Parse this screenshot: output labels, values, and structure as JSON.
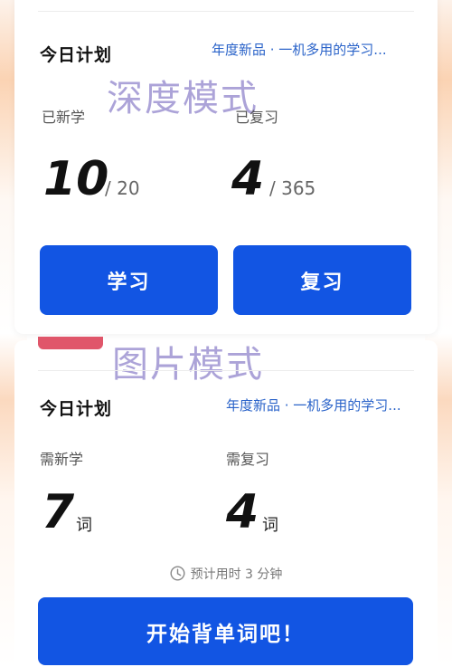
{
  "deep_mode": {
    "watermark": "深度模式",
    "plan_title": "今日计划",
    "plan_link": "年度新品 · 一机多用的学习...",
    "new_label": "已新学",
    "new_count": "10",
    "new_total": "/ 20",
    "review_label": "已复习",
    "review_count": "4",
    "review_total": "/ 365",
    "learn_button": "学习",
    "review_button": "复习"
  },
  "image_mode": {
    "watermark": "图片模式",
    "plan_title": "今日计划",
    "plan_link": "年度新品 · 一机多用的学习...",
    "new_label": "需新学",
    "new_count": "7",
    "new_unit": "词",
    "review_label": "需复习",
    "review_count": "4",
    "review_unit": "词",
    "estimate": "预计用时 3 分钟",
    "start_button": "开始背单词吧！"
  },
  "colors": {
    "accent": "#1255e3",
    "link": "#2a63c9",
    "watermark": "#a89fd6"
  },
  "icons": {
    "clock": "clock-icon"
  }
}
